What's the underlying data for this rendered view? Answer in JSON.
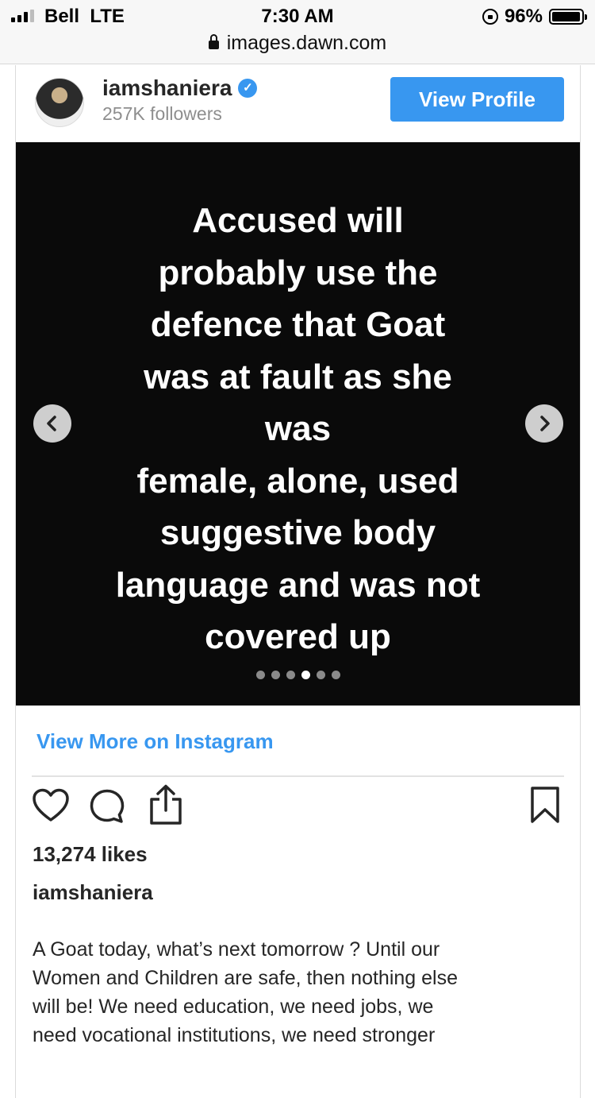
{
  "status_bar": {
    "carrier": "Bell",
    "network": "LTE",
    "time": "7:30 AM",
    "battery": "96%",
    "battery_level": 0.96
  },
  "browser": {
    "url": "images.dawn.com"
  },
  "post": {
    "username": "iamshaniera",
    "followers": "257K followers",
    "view_profile": "View Profile",
    "image_text_lines": [
      "Accused will",
      "probably use the",
      "defence that Goat",
      "was at fault as she",
      "was",
      "female, alone, used",
      "suggestive body",
      "language and was not",
      "covered up"
    ],
    "carousel": {
      "count": 6,
      "active": 4
    },
    "view_more": "View More on Instagram",
    "likes": "13,274 likes",
    "caption_user": "iamshaniera",
    "caption_lines": [
      "A Goat today, what’s next tomorrow ? Until our",
      "Women and Children are safe, then nothing else",
      "will be! We need education, we need jobs, we",
      "need vocational institutions, we need stronger"
    ]
  },
  "colors": {
    "accent": "#3897f0",
    "text": "#262626",
    "muted": "#8e8e8e",
    "media_bg": "#0a0a0a"
  },
  "icons": [
    "signal-icon",
    "padlock-icon",
    "rotation-lock-icon",
    "battery-icon",
    "verified-badge-icon",
    "chevron-left-icon",
    "chevron-right-icon",
    "heart-icon",
    "comment-icon",
    "share-icon",
    "bookmark-icon"
  ]
}
